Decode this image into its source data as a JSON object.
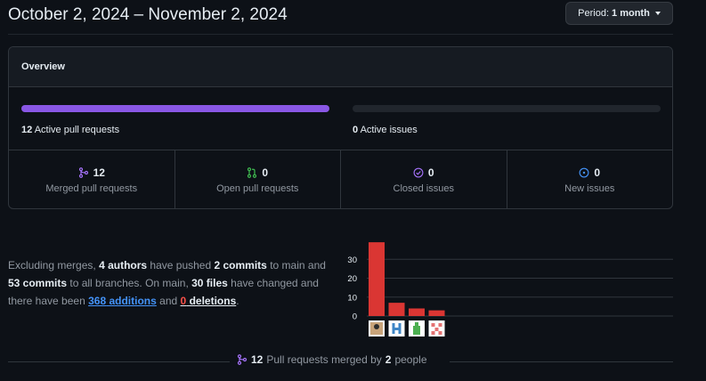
{
  "header": {
    "title": "October 2, 2024 – November 2, 2024",
    "period_prefix": "Period:",
    "period_value": "1 month"
  },
  "overview": {
    "title": "Overview",
    "pull_requests_count": "12",
    "pull_requests_label": "Active pull requests",
    "pull_requests_fill": 1.0,
    "issues_count": "0",
    "issues_label": "Active issues",
    "issues_fill": 0.0,
    "stats": [
      {
        "icon": "git-merge-icon",
        "count": "12",
        "label": "Merged pull requests",
        "color": "#a371f7"
      },
      {
        "icon": "git-pull-request-icon",
        "count": "0",
        "label": "Open pull requests",
        "color": "#3fb950"
      },
      {
        "icon": "check-circle-icon",
        "count": "0",
        "label": "Closed issues",
        "color": "#a371f7"
      },
      {
        "icon": "issue-opened-icon",
        "count": "0",
        "label": "New issues",
        "color": "#4493f8"
      }
    ]
  },
  "summary": {
    "p1": "Excluding merges,",
    "authors": "4 authors",
    "p2": "have pushed",
    "commits_main": "2 commits",
    "p3": "to main and",
    "commits_all": "53 commits",
    "p4": "to all branches. On main,",
    "files": "30 files",
    "p5": "have changed and there have been",
    "additions_num": "368",
    "additions_word": "additions",
    "p6": "and",
    "deletions_num": "0",
    "deletions_word": "deletions",
    "p7": "."
  },
  "chart_data": {
    "type": "bar",
    "categories": [
      "author-1",
      "author-2",
      "author-3",
      "author-4"
    ],
    "values": [
      39,
      7,
      4,
      3
    ],
    "ylim": [
      0,
      40
    ],
    "yticks": [
      "0",
      "10",
      "20",
      "30"
    ],
    "grid": true,
    "bar_color": "#da3633",
    "avatar_colors": [
      "#c9a47a",
      "#3f86c6",
      "#4caf50",
      "#e57373"
    ]
  },
  "footer": {
    "count": "12",
    "text1": "Pull requests merged by",
    "people": "2",
    "text2": "people"
  },
  "colors": {
    "merged": "#a371f7",
    "bar_fill": "#8957e5",
    "addition": "#4493f8",
    "deletion": "#f85149"
  }
}
